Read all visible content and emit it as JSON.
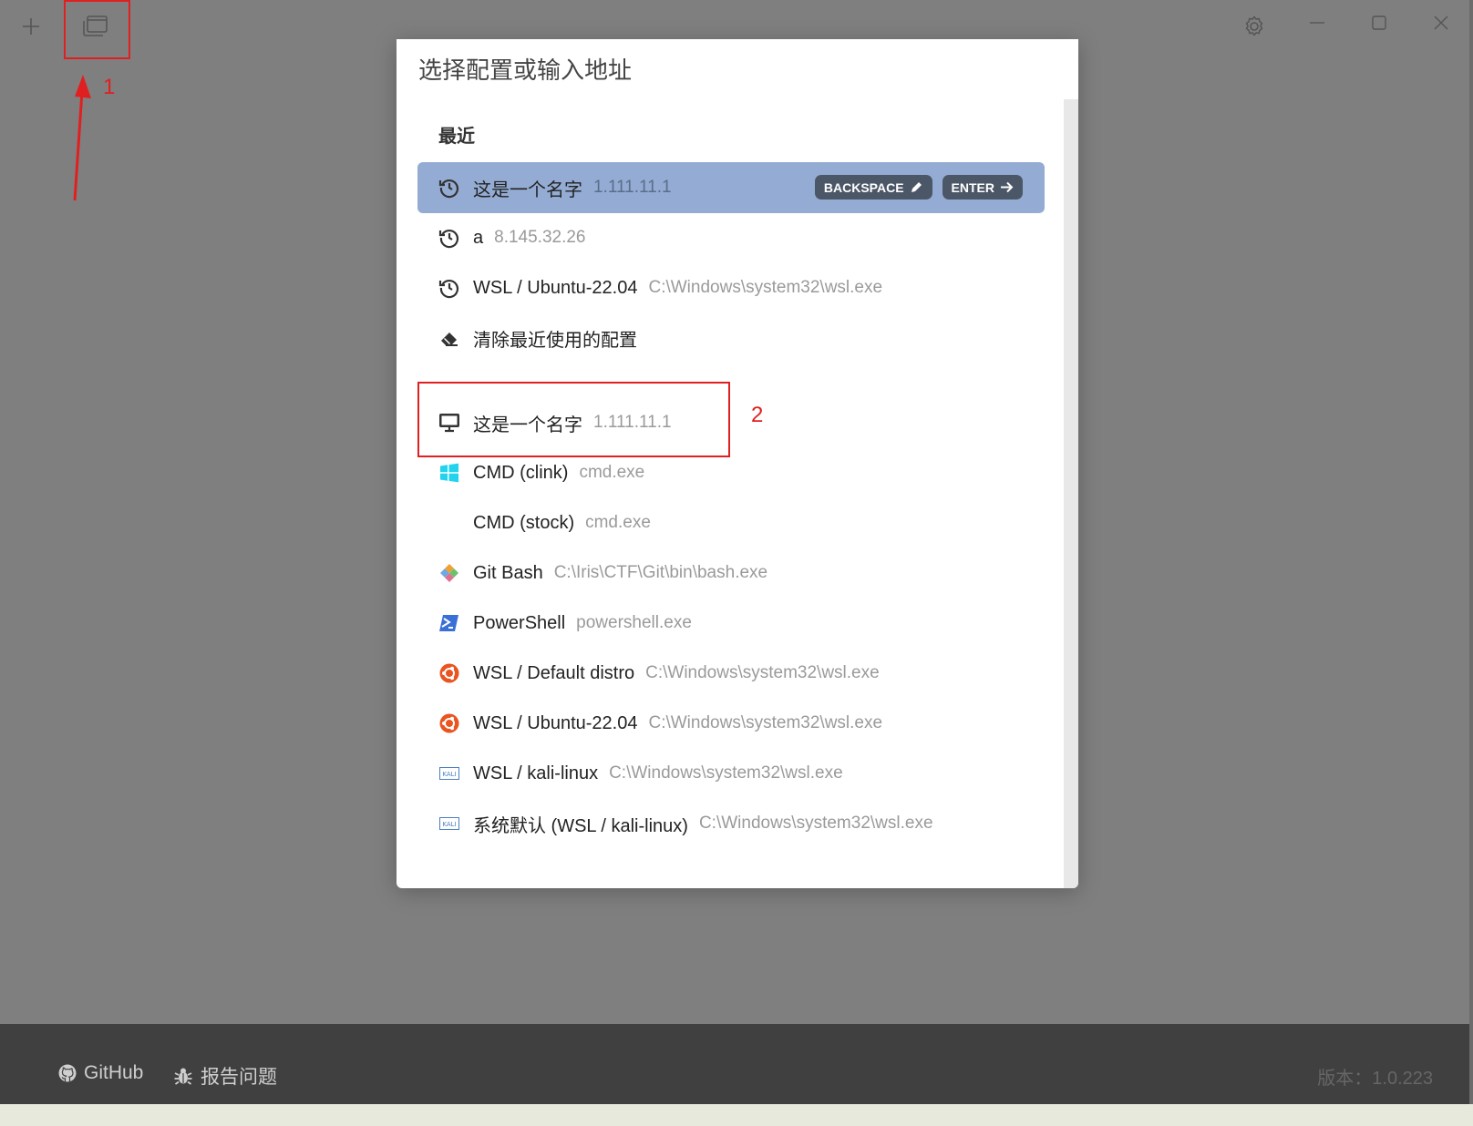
{
  "modal": {
    "title": "选择配置或输入地址",
    "recent_label": "最近",
    "recent": [
      {
        "name": "这是一个名字",
        "detail": "1.111.11.1",
        "icon": "history-icon",
        "active": true
      },
      {
        "name": "a",
        "detail": "8.145.32.26",
        "icon": "history-icon"
      },
      {
        "name": "WSL / Ubuntu-22.04",
        "detail": "C:\\Windows\\system32\\wsl.exe",
        "icon": "history-icon"
      },
      {
        "name": "清除最近使用的配置",
        "detail": "",
        "icon": "eraser-icon"
      }
    ],
    "keys": {
      "backspace": "BACKSPACE",
      "enter": "ENTER"
    },
    "profiles": [
      {
        "name": "这是一个名字",
        "detail": "1.111.11.1",
        "icon": "monitor-icon"
      },
      {
        "name": "CMD (clink)",
        "detail": "cmd.exe",
        "icon": "windows-icon"
      },
      {
        "name": "CMD (stock)",
        "detail": "cmd.exe",
        "icon": ""
      },
      {
        "name": "Git Bash",
        "detail": "C:\\Iris\\CTF\\Git\\bin\\bash.exe",
        "icon": "git-icon"
      },
      {
        "name": "PowerShell",
        "detail": "powershell.exe",
        "icon": "powershell-icon"
      },
      {
        "name": "WSL / Default distro",
        "detail": "C:\\Windows\\system32\\wsl.exe",
        "icon": "ubuntu-icon"
      },
      {
        "name": "WSL / Ubuntu-22.04",
        "detail": "C:\\Windows\\system32\\wsl.exe",
        "icon": "ubuntu-icon"
      },
      {
        "name": "WSL / kali-linux",
        "detail": "C:\\Windows\\system32\\wsl.exe",
        "icon": "kali-icon"
      },
      {
        "name": "系统默认 (WSL / kali-linux)",
        "detail": "C:\\Windows\\system32\\wsl.exe",
        "icon": "kali-icon"
      }
    ]
  },
  "annotations": {
    "one": "1",
    "two": "2"
  },
  "footer": {
    "github": "GitHub",
    "report": "报告问题",
    "version": "版本：1.0.223"
  },
  "colors": {
    "active_row": "#94acd3",
    "annotation": "#e02020",
    "kbd": "#4b5667"
  },
  "icons": {
    "kali_text": "KALI"
  }
}
